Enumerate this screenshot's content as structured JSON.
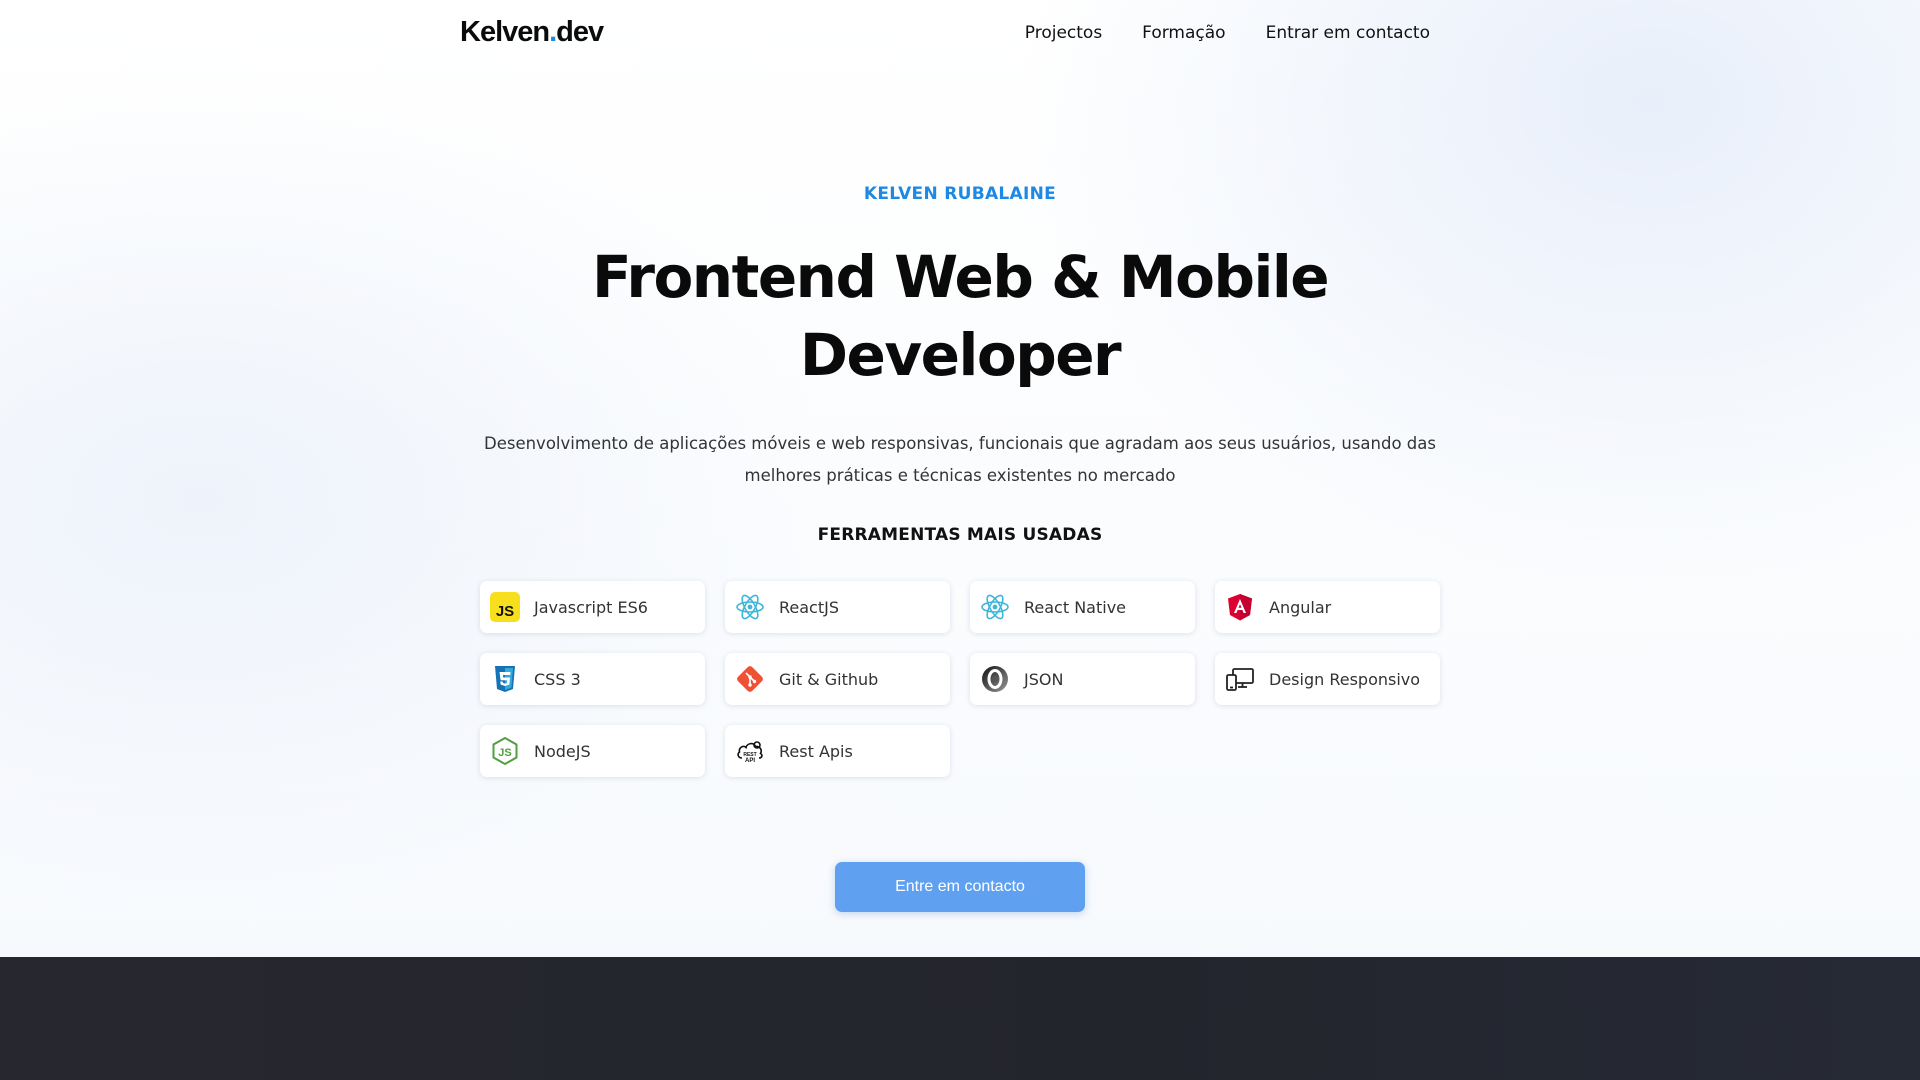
{
  "nav": {
    "logo_main": "Kelven",
    "logo_dot": ".",
    "logo_tld": "dev",
    "links": [
      "Projectos",
      "Formação",
      "Entrar em contacto"
    ]
  },
  "hero": {
    "eyebrow": "KELVEN RUBALAINE",
    "title_line1": "Frontend Web & Mobile",
    "title_line2": "Developer",
    "subtitle_line1": "Desenvolvimento de aplicações móveis e web responsivas, funcionais que agradam aos seus usuários, usando das",
    "subtitle_line2": "melhores práticas e técnicas existentes no mercado",
    "tools_heading": "FERRAMENTAS MAIS USADAS",
    "tools": [
      {
        "label": "Javascript ES6",
        "icon": "javascript-icon"
      },
      {
        "label": "ReactJS",
        "icon": "react-icon"
      },
      {
        "label": "React Native",
        "icon": "react-native-icon"
      },
      {
        "label": "Angular",
        "icon": "angular-icon"
      },
      {
        "label": "CSS 3",
        "icon": "css3-icon"
      },
      {
        "label": "Git & Github",
        "icon": "git-icon"
      },
      {
        "label": "JSON",
        "icon": "json-icon"
      },
      {
        "label": "Design Responsivo",
        "icon": "responsive-devices-icon"
      },
      {
        "label": "NodeJS",
        "icon": "nodejs-icon"
      },
      {
        "label": "Rest Apis",
        "icon": "rest-api-icon"
      }
    ],
    "cta_label": "Entre em contacto"
  },
  "colors": {
    "accent": "#1e88e5",
    "cta": "#5fa1f0",
    "footer": "#25262e"
  }
}
